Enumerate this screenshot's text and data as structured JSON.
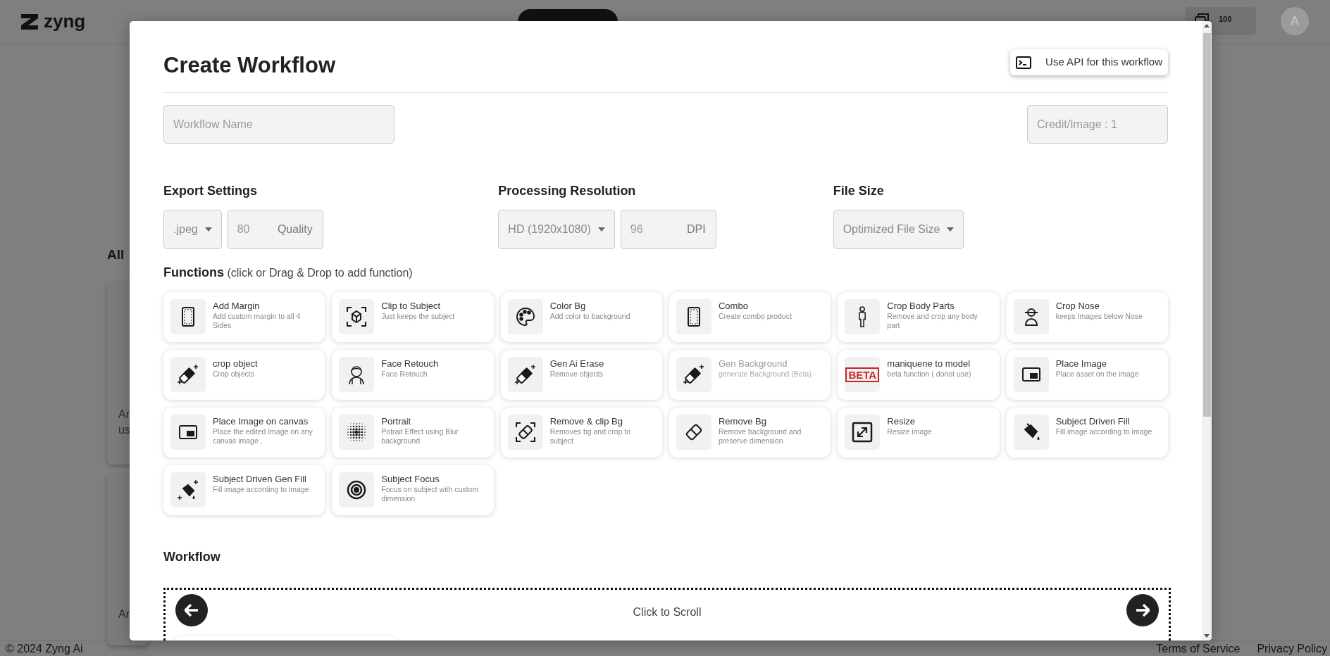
{
  "header": {
    "logo": "zyng",
    "tabs": [
      {
        "selected": true
      }
    ],
    "credits": "100",
    "avatar": "A"
  },
  "background": {
    "heading": "All",
    "cards": [
      {
        "lines": [
          "Ar",
          "us"
        ]
      },
      {
        "lines": [
          "Ar"
        ]
      }
    ]
  },
  "footer": {
    "copyright": "© 2024 Zyng Ai",
    "links": [
      "Terms of Service",
      "Privacy Policy"
    ]
  },
  "modal": {
    "title": "Create Workflow",
    "api_button": "Use API for this workflow",
    "workflow_name": {
      "placeholder": "Workflow Name"
    },
    "credit": {
      "placeholder": "Credit/Image : 1"
    },
    "settings": [
      {
        "label": "Export Settings",
        "controls": [
          {
            "kind": "select",
            "value": ".jpeg"
          },
          {
            "kind": "number",
            "value": "80",
            "unit": "Quality"
          }
        ]
      },
      {
        "label": "Processing Resolution",
        "controls": [
          {
            "kind": "select",
            "value": "HD (1920x1080)"
          },
          {
            "kind": "number",
            "value": "96",
            "unit": "DPI"
          }
        ]
      },
      {
        "label": "File Size",
        "controls": [
          {
            "kind": "select",
            "value": "Optimized File Size"
          }
        ]
      }
    ],
    "functions_label": "Functions",
    "functions_hint": "(click or Drag & Drop to add function)",
    "functions": [
      {
        "kind": "frame",
        "title": "Add Margin",
        "desc": "Add custom margin to all 4 Sides",
        "disabled": false
      },
      {
        "kind": "box",
        "title": "Clip to Subject",
        "desc": "Just keeps the subject",
        "disabled": false
      },
      {
        "kind": "palette",
        "title": "Color Bg",
        "desc": "Add color to background",
        "disabled": false
      },
      {
        "kind": "frame",
        "title": "Combo",
        "desc": "Create combo product",
        "disabled": false
      },
      {
        "kind": "figure",
        "title": "Crop Body Parts",
        "desc": "Remove and crop any body part",
        "disabled": false
      },
      {
        "kind": "bust",
        "title": "Crop Nose",
        "desc": "keeps Images below Nose",
        "disabled": false
      },
      {
        "kind": "eraser-sparkle",
        "title": "crop object",
        "desc": "Crop objects",
        "disabled": false
      },
      {
        "kind": "face",
        "title": "Face Retouch",
        "desc": "Face Retouch",
        "disabled": false
      },
      {
        "kind": "eraser-sparkle",
        "title": "Gen Ai Erase",
        "desc": "Remove objects",
        "disabled": false
      },
      {
        "kind": "eraser-sparkle",
        "title": "Gen Background",
        "desc": "generate Background (Beta)",
        "disabled": true
      },
      {
        "kind": "stamp",
        "stamp": "BETA",
        "title": "maniquene to model",
        "desc": "beta function ( donot use)",
        "disabled": false
      },
      {
        "kind": "pip",
        "title": "Place Image",
        "desc": "Place asset on the image",
        "disabled": false
      },
      {
        "kind": "pip",
        "title": "Place Image on canvas",
        "desc": "Place the edited Image on any canvas image .",
        "disabled": false
      },
      {
        "kind": "dots",
        "title": "Portrait",
        "desc": "Potrait Effect using Blur background",
        "disabled": false
      },
      {
        "kind": "eraser-frame",
        "title": "Remove & clip Bg",
        "desc": "Removes bg and crop to subject",
        "disabled": false
      },
      {
        "kind": "eraser",
        "title": "Remove Bg",
        "desc": "Remove background and preserve dimension",
        "disabled": false
      },
      {
        "kind": "resize",
        "title": "Resize",
        "desc": "Resize image",
        "disabled": false
      },
      {
        "kind": "bucket",
        "title": "Subject Driven Fill",
        "desc": "Fill image according to image",
        "disabled": false
      },
      {
        "kind": "bucket-sparkle",
        "title": "Subject Driven Gen Fill",
        "desc": "Fill image according to image",
        "disabled": false
      },
      {
        "kind": "target",
        "title": "Subject Focus",
        "desc": "Focus on subject with custom dimension",
        "disabled": false
      }
    ],
    "workflow_label": "Workflow",
    "scroll_hint": "Click to Scroll"
  }
}
